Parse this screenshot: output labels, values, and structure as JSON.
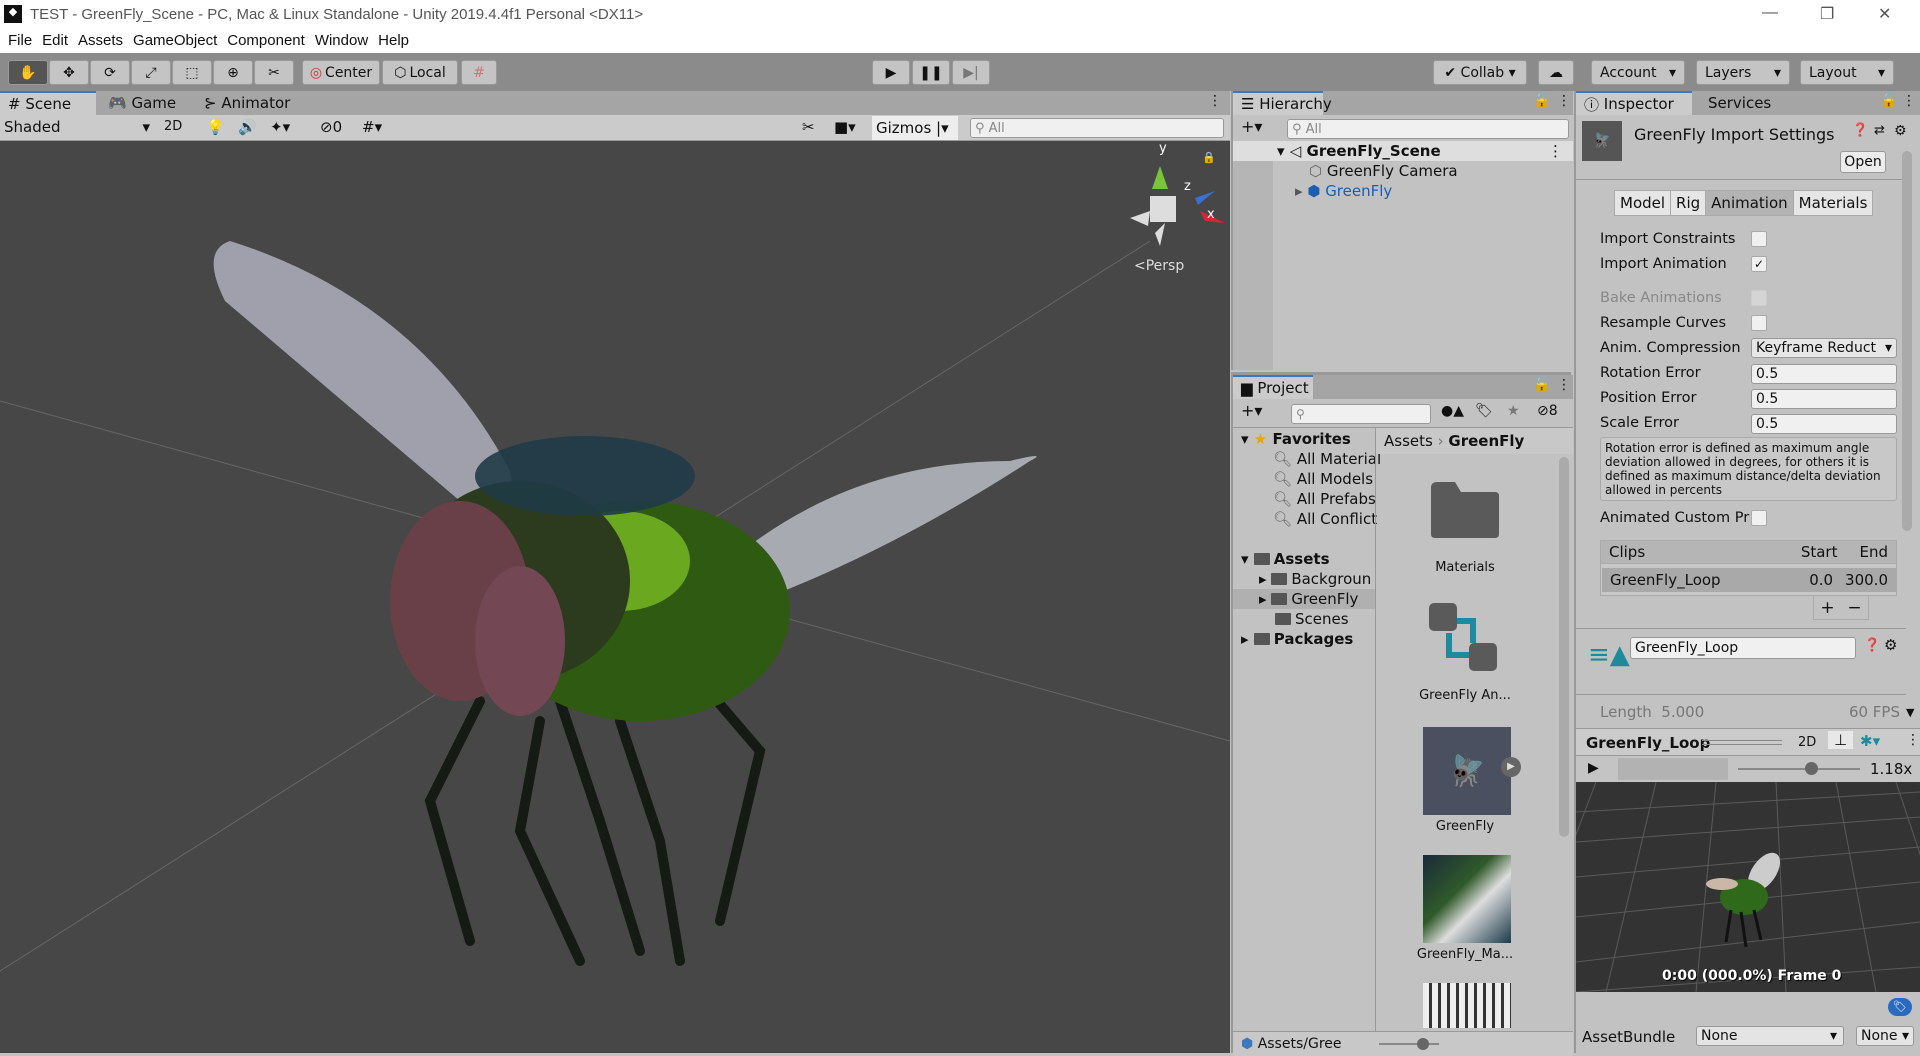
{
  "window": {
    "title": "TEST - GreenFly_Scene - PC, Mac & Linux Standalone - Unity 2019.4.4f1 Personal <DX11>"
  },
  "menu": [
    "File",
    "Edit",
    "Assets",
    "GameObject",
    "Component",
    "Window",
    "Help"
  ],
  "toolbar": {
    "center": "Center",
    "local": "Local",
    "collab": "Collab",
    "account": "Account",
    "layers": "Layers",
    "layout": "Layout"
  },
  "scene": {
    "tabs": [
      "Scene",
      "Game",
      "Animator"
    ],
    "shading": "Shaded",
    "mode_2d": "2D",
    "hidden_count": "0",
    "gizmos": "Gizmos",
    "search_placeholder": "All",
    "persp": "Persp",
    "axis_y": "y",
    "axis_z": "z",
    "axis_x": "x"
  },
  "hierarchy": {
    "title": "Hierarchy",
    "search_placeholder": "All",
    "scene": "GreenFly_Scene",
    "items": [
      "GreenFly Camera",
      "GreenFly"
    ]
  },
  "project": {
    "title": "Project",
    "hidden_count": "8",
    "favorites": "Favorites",
    "fav_items": [
      "All Material",
      "All Models",
      "All Prefabs",
      "All Conflict"
    ],
    "assets": "Assets",
    "asset_folders": [
      "Backgroun",
      "GreenFly",
      "Scenes"
    ],
    "packages": "Packages",
    "breadcrumb": [
      "Assets",
      "GreenFly"
    ],
    "grid_items": [
      "Materials",
      "GreenFly An...",
      "GreenFly",
      "GreenFly_Ma..."
    ],
    "footer_path": "Assets/Gree"
  },
  "inspector": {
    "tabs": [
      "Inspector",
      "Services"
    ],
    "title": "GreenFly Import Settings",
    "open": "Open",
    "subtabs": [
      "Model",
      "Rig",
      "Animation",
      "Materials"
    ],
    "active_subtab": "Animation",
    "import_constraints": {
      "label": "Import Constraints",
      "checked": false
    },
    "import_animation": {
      "label": "Import Animation",
      "checked": true
    },
    "bake_animations": {
      "label": "Bake Animations",
      "checked": false
    },
    "resample_curves": {
      "label": "Resample Curves",
      "checked": false
    },
    "anim_compression": {
      "label": "Anim. Compression",
      "value": "Keyframe Reduct"
    },
    "rotation_error": {
      "label": "Rotation Error",
      "value": "0.5"
    },
    "position_error": {
      "label": "Position Error",
      "value": "0.5"
    },
    "scale_error": {
      "label": "Scale Error",
      "value": "0.5"
    },
    "help": "Rotation error is defined as maximum angle deviation allowed in degrees, for others it is defined as maximum distance/delta deviation allowed in percents",
    "animated_custom": {
      "label": "Animated Custom Pr",
      "checked": false
    },
    "clips": {
      "header": "Clips",
      "start": "Start",
      "end": "End",
      "rows": [
        {
          "name": "GreenFly_Loop",
          "start": "0.0",
          "end": "300.0"
        }
      ]
    },
    "clip_name": "GreenFly_Loop",
    "length_label": "Length",
    "length": "5.000",
    "fps": "60 FPS",
    "preview": {
      "title": "GreenFly_Loop",
      "mode_2d": "2D",
      "speed": "1.18x",
      "status": "0:00 (000.0%) Frame 0"
    },
    "assetbundle": {
      "label": "AssetBundle",
      "value": "None",
      "variant": "None"
    }
  },
  "colors": {
    "accent": "#3a79bb",
    "scene_bg": "#474747",
    "panel": "#c2c2c2",
    "teal": "#1e8b9b"
  }
}
